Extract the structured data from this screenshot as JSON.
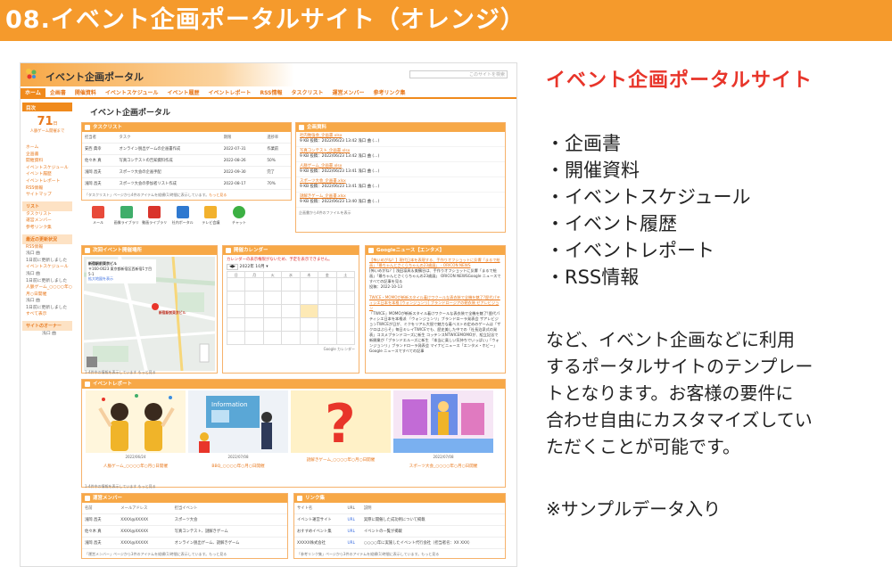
{
  "banner": {
    "title": "08.イベント企画ポータルサイト（オレンジ）"
  },
  "right": {
    "title": "イベント企画ポータルサイト",
    "items": [
      "・企画書",
      "・開催資料",
      "・イベントスケジュール",
      "・イベント履歴",
      "・イベントレポート",
      "・RSS情報"
    ],
    "para": [
      "など、イベント企画などに利用",
      "するポータルサイトのテンプレー",
      "トとなります。お客様の要件に",
      "合わせ自由にカスタマイズしてい",
      "ただくことが可能です。"
    ],
    "note": "※サンプルデータ入り"
  },
  "site": {
    "title": "イベント企画ポータル",
    "search_placeholder": "このサイトを検索",
    "nav": [
      "ホーム",
      "企画書",
      "開催資料",
      "イベントスケジュール",
      "イベント履歴",
      "イベントレポート",
      "RSS情報",
      "タスクリスト",
      "運営メンバー",
      "参考リンク集"
    ],
    "main_title": "イベント企画ポータル",
    "side": {
      "countdown_head": "目次",
      "days": "71",
      "days_unit": "日",
      "days_label": "人脈ゲーム開催まで",
      "links": [
        "ホーム",
        "企画書",
        "開催資料",
        "イベントスケジュール",
        "イベント履歴",
        "イベントレポート",
        "RSS情報",
        "サイトマップ"
      ],
      "list_head": "リスト",
      "list_links": [
        "タスクリスト",
        "運営メンバー",
        "参考リンク集"
      ],
      "recent_head": "最近の更新状況",
      "recent": [
        "RSS情報",
        "浅口 曲",
        "1日前に更新しました",
        "イベントスケジュール",
        "浅口 曲",
        "1日前に更新しました",
        "人脈ゲーム_○○○○年○月○日開催",
        "浅口 曲",
        "1日前に更新しました",
        "すべて表示"
      ],
      "owner_head": "サイトのオーナー",
      "owner": "浅口 曲"
    },
    "task": {
      "head": "タスクリスト",
      "cols": [
        "担当者",
        "タスク",
        "期限",
        "進捗率"
      ],
      "rows": [
        [
          "安西 典幸",
          "オンライン脱出ゲームの企画書作成",
          "2022-07-31",
          "作業前"
        ],
        [
          "佐々木 真",
          "写真コンテストの告知資料作成",
          "2022-08-26",
          "50%"
        ],
        [
          "浅岡 昌夫",
          "スポーツ大会の企画手配",
          "2022-09-30",
          "完了"
        ],
        [
          "浅岡 昌夫",
          "スポーツ大会の参加者リスト作成",
          "2022-08-17",
          "70%"
        ]
      ],
      "foot": "「タスクリスト」ページから4件のアイテムを縦横(1)時間に表示しています。",
      "more": "もっと見る"
    },
    "apps": [
      "メール",
      "画像ライブラリ",
      "動画ライブラリ",
      "社内ポータル",
      "テレビ会議",
      "チャット"
    ],
    "docs": {
      "head": "企画資料",
      "files": [
        [
          "社内勉強会_企画書.xlsx",
          "9 KB 投稿：2022/06/23 13:42 浅口 曲 (…)"
        ],
        [
          "写真コンテスト_企画書.xlsx",
          "9 KB 投稿：2022/06/23 13:42 浅口 曲 (…)"
        ],
        [
          "人脈ゲーム_企画書.xlsx",
          "9 KB 投稿：2022/06/23 13:41 浅口 曲 (…)"
        ],
        [
          "スポーツ大会_企画書.xlsx",
          "9 KB 投稿：2022/06/23 13:41 浅口 曲 (…)"
        ],
        [
          "謎解きゲーム_企画書.xlsx",
          "9 KB 投稿：2022/06/23 13:40 浅口 曲 (…)"
        ]
      ],
      "foot": "企画書から4件のファイルを表示"
    },
    "venue": {
      "head": "次回イベント開催場所",
      "name": "新宿駅前東京ビル",
      "addr": "〒160-0023 東京都新宿区西新宿1丁目5-1",
      "link": "拡大地図を表示",
      "pin": "新宿駅前東京ビル",
      "foot": "1-4件中の情報を表示しています もっと見る"
    },
    "calendar": {
      "head": "開催カレンダー",
      "msg": "カレンダーの表示権限がないため、予定を表示できません。",
      "month": "2022年 10月",
      "days": [
        "日",
        "月",
        "火",
        "水",
        "木",
        "金",
        "土"
      ],
      "google": "Google カレンダー"
    },
    "news": {
      "head": "Googleニュース【エンタメ】",
      "items": [
        [
          "【怖いめがね？】現代日本を表現する、手作りオフショットに反響「まるで絵画」「最ちゃんとさくらちゃんの23歳展」 - ORICON NEWS",
          "[怖いめがね？] 浅田凛具＆美鶴谷は、手作りオフショットに反響「まるで絵画」「最ちゃんとさくらちゃんの23歳展」 ORICON NEWSGoogle ニュースですべての記事を見る",
          "投稿：2022-10-13"
        ],
        [
          "TWICE・MOMOが斬新スタイル着けワクールな表衣装で全機を魅了?歴代パティシエ日本を本格 [ウォンジョンリ] ブランドロージアの朝衣装 ゼアレビジョン",
          "「TWICE」MOMOが斬新スタイル着けワクールな表衣装で全機を魅了!歴代パティシエ日本を本格派 「ウォンジョンリ」ブランドローラ発表会 ザアレビジョンTWICEが日が、ミクをリアル大胆で魅力な着ベストの定めのゲームは「ザクロはぶらそ」毎日キレイTWICEでも、歴史美した中での「社長泊泉式の発表」コスメブランドコーズに新生 コッテンスNTWICEMOMOが、組立記念で新開業が「ブランドエルーズに新生 「本当に楽しい気持ちでいっぱい」「ウォンジョンリ」ブランドローラ発表会 マイナビニュース「エンタメ・ホビー」Google ニュースですべての記事"
        ]
      ]
    },
    "report": {
      "head": "イベントレポート",
      "items": [
        [
          "2022/06/24",
          "人脈ゲーム_○○○○年○月○日開催"
        ],
        [
          "2022/07/08",
          "BBQ_○○○○年○月○日開催"
        ],
        [
          "",
          "謎解きゲーム_○○○○年○月○日開催"
        ],
        [
          "2022/07/08",
          "スポーツ大会_○○○○年○月○日開催"
        ]
      ],
      "foot": "1-4件中の情報を表示しています もっと見る"
    },
    "members": {
      "head": "運営メンバー",
      "cols": [
        "名前",
        "メールアドレス",
        "担当イベント"
      ],
      "rows": [
        [
          "浅岡 昌夫",
          "XXXX@XXXXX",
          "スポーツ大会"
        ],
        [
          "佐々木 真",
          "XXXX@XXXXX",
          "写真コンテスト、謎解きゲーム"
        ],
        [
          "浅岡 昌夫",
          "XXXX@XXXXX",
          "オンライン脱出ゲーム、謎解きゲーム"
        ]
      ],
      "foot": "「運営メンバー」ページから3件のアイテムを縦横(1)時間に表示しています。もっと見る"
    },
    "links": {
      "head": "リンク集",
      "cols": [
        "サイト名",
        "URL",
        "説明"
      ],
      "rows": [
        [
          "イベント運営サイト",
          "URL",
          "実際に開催した成功例について掲載"
        ],
        [
          "おすすめイベント集",
          "URL",
          "イベントの一覧が掲載"
        ],
        [
          "XXXXX株式会社",
          "URL",
          "○○○○年に実施したイベント代行会社（担当者名：XX XXX）"
        ]
      ],
      "foot": "「参考リンク集」ページから3件のアイテムを縦横(1)時間に表示しています。もっと見る"
    }
  },
  "colors": {
    "accent": "#f08a1c",
    "banner": "#f59a2c",
    "title_red": "#e8352a"
  }
}
